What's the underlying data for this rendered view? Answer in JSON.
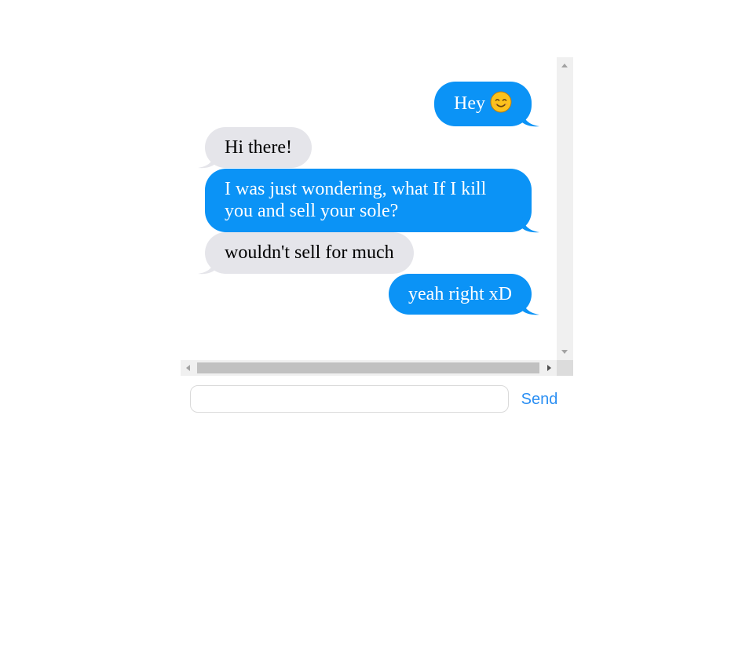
{
  "colors": {
    "sent_bubble": "#0b93f6",
    "received_bubble": "#e5e5ea",
    "sent_text": "#ffffff",
    "received_text": "#000000",
    "send_button": "#2b8ff3"
  },
  "messages": [
    {
      "sender": "me",
      "text": "Hey",
      "emoji": "smiling-face-icon"
    },
    {
      "sender": "them",
      "text": "Hi there!"
    },
    {
      "sender": "me",
      "text": "I was just wondering, what If I kill you and sell your sole?"
    },
    {
      "sender": "them",
      "text": "wouldn't sell for much"
    },
    {
      "sender": "me",
      "text": "yeah right xD"
    }
  ],
  "composer": {
    "input_value": "",
    "input_placeholder": "",
    "send_label": "Send"
  }
}
